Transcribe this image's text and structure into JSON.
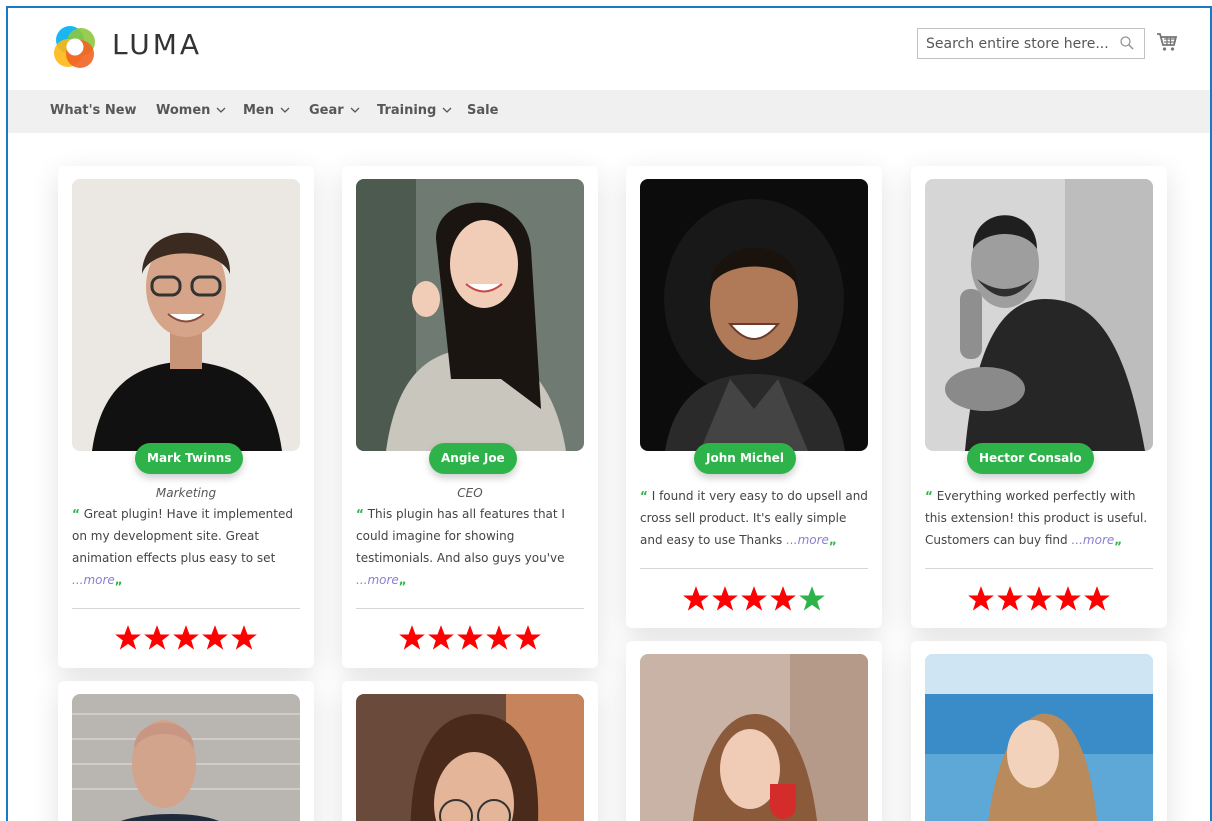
{
  "header": {
    "brand": "LUMA",
    "search_placeholder": "Search entire store here...",
    "logo_colors": [
      "#f26322",
      "#00aeef",
      "#8dc63f",
      "#fdb813"
    ]
  },
  "nav": {
    "items": [
      {
        "label": "What's New",
        "has_dropdown": false
      },
      {
        "label": "Women",
        "has_dropdown": true
      },
      {
        "label": "Men",
        "has_dropdown": true
      },
      {
        "label": "Gear",
        "has_dropdown": true
      },
      {
        "label": "Training",
        "has_dropdown": true
      },
      {
        "label": "Sale",
        "has_dropdown": false
      }
    ]
  },
  "colors": {
    "accent_green": "#2eb34a",
    "star_red": "#ff0000",
    "star_green": "#2eb34a",
    "more_link": "#8a7fd4"
  },
  "testimonials": [
    {
      "name": "Mark Twinns",
      "role": "Marketing",
      "quote": "Great plugin! Have it implemented on my development site. Great animation effects plus easy to set",
      "more": "...more",
      "rating": 5,
      "star_color": "red"
    },
    {
      "name": "Angie Joe",
      "role": "CEO",
      "quote": "This plugin has all features that I could imagine for showing testimonials. And also guys you've",
      "more": "...more",
      "rating": 5,
      "star_color": "red"
    },
    {
      "name": "John Michel",
      "role": "",
      "quote": "I found it very easy to do upsell and cross sell product. It's eally simple and easy to use Thanks",
      "more": "...more",
      "rating": 5,
      "star_color": "red",
      "last_star_green": true
    },
    {
      "name": "Hector Consalo",
      "role": "",
      "quote": "Everything worked perfectly with this extension! this product is useful. Customers can buy find",
      "more": "...more",
      "rating": 5,
      "star_color": "red"
    }
  ]
}
